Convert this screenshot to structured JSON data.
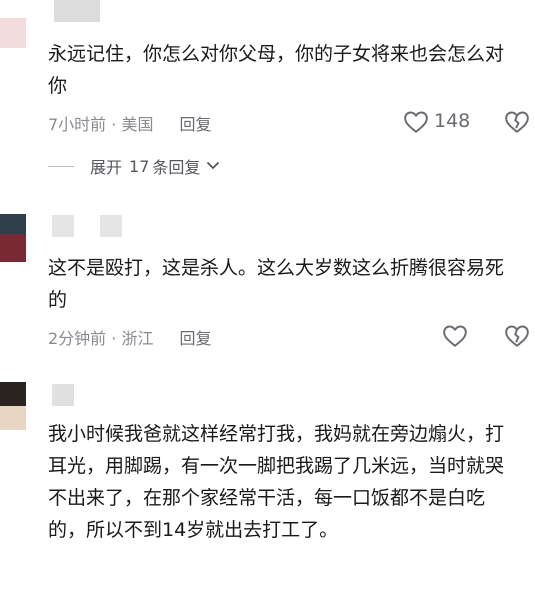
{
  "comments": [
    {
      "text": "永远记住，你怎么对你父母，你的子女将来也会怎么对你",
      "time_location": "7小时前 · 美国",
      "reply_label": "回复",
      "like_count": "148",
      "expand_label": "展开",
      "expand_count": "17",
      "expand_suffix": "条回复"
    },
    {
      "text": "这不是殴打，这是杀人。这么大岁数这么折腾很容易死的",
      "time_location": "2分钟前 · 浙江",
      "reply_label": "回复",
      "like_count": ""
    },
    {
      "text": "我小时候我爸就这样经常打我，我妈就在旁边煽火，打耳光，用脚踢，有一次一脚把我踢了几米远，当时就哭不出来了，在那个家经常干活，每一口饭都不是白吃的，所以不到14岁就出去打工了。"
    }
  ],
  "icons": {
    "like": "heart-icon",
    "dislike": "broken-heart-icon",
    "expand": "chevron-down-icon"
  },
  "colors": {
    "text": "#1a1a1a",
    "meta": "#8a8b91",
    "icon": "#6a6b72"
  }
}
